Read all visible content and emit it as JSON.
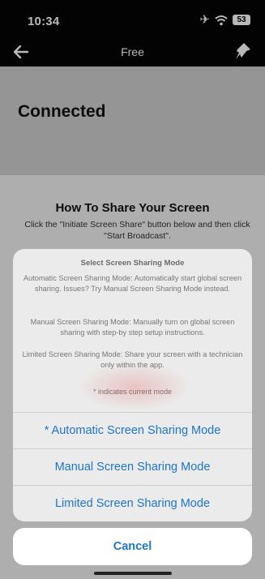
{
  "status_bar": {
    "time": "10:34",
    "battery": "53"
  },
  "nav": {
    "title": "Free"
  },
  "main": {
    "status": "Connected",
    "howto_title": "How To Share Your Screen",
    "howto_text": "Click the \"Initiate Screen Share\" button below and then click \"Start Broadcast\"."
  },
  "sheet": {
    "title": "Select Screen Sharing Mode",
    "desc_automatic": "Automatic Screen Sharing Mode: Automatically start global screen sharing. Issues? Try Manual Screen Sharing Mode instead.",
    "desc_manual": "Manual Screen Sharing Mode: Manually turn on global screen sharing with step-by step setup instructions.",
    "desc_limited": "Limited Screen Sharing Mode: Share your screen with a technician only within the app.",
    "note": "* indicates current mode",
    "options": [
      "* Automatic Screen Sharing Mode",
      "Manual Screen Sharing Mode",
      "Limited Screen Sharing Mode"
    ],
    "cancel": "Cancel"
  },
  "icons": [
    "airplane-icon",
    "wifi-icon",
    "battery-icon",
    "back-arrow-icon",
    "pin-icon"
  ],
  "colors": {
    "accent": "#1e74c8",
    "topbar": "#050505"
  }
}
